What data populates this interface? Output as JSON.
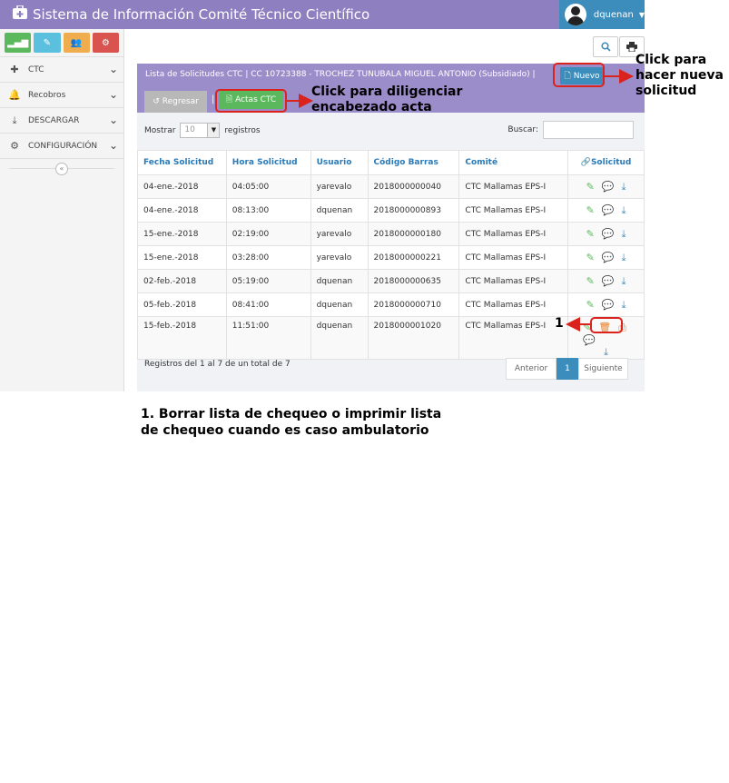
{
  "header": {
    "app_title": "Sistema de Información Comité Técnico Científico",
    "username": "dquenan"
  },
  "sidebar": {
    "items": [
      {
        "label": "CTC",
        "icon": "medkit-icon"
      },
      {
        "label": "Recobros",
        "icon": "bell-icon"
      },
      {
        "label": "DESCARGAR",
        "icon": "download-icon"
      },
      {
        "label": "CONFIGURACIÓN",
        "icon": "cogs-icon"
      }
    ]
  },
  "panel": {
    "title": "Lista de Solicitudes CTC | CC 10723388 - TROCHEZ TUNUBALA MIGUEL ANTONIO (Subsidiado) |",
    "nuevo_label": "Nuevo",
    "regresar_label": "Regresar",
    "actas_label": "Actas CTC"
  },
  "table_controls": {
    "show_label": "Mostrar",
    "page_length": "10",
    "records_label": "registros",
    "search_label": "Buscar:"
  },
  "table": {
    "headers": [
      "Fecha Solicitud",
      "Hora Solicitud",
      "Usuario",
      "Código Barras",
      "Comité",
      "Solicitud"
    ],
    "rows": [
      [
        "04-ene.-2018",
        "04:05:00",
        "yarevalo",
        "2018000000040",
        "CTC Mallamas EPS-I"
      ],
      [
        "04-ene.-2018",
        "08:13:00",
        "dquenan",
        "2018000000893",
        "CTC Mallamas EPS-I"
      ],
      [
        "15-ene.-2018",
        "02:19:00",
        "yarevalo",
        "2018000000180",
        "CTC Mallamas EPS-I"
      ],
      [
        "15-ene.-2018",
        "03:28:00",
        "yarevalo",
        "2018000000221",
        "CTC Mallamas EPS-I"
      ],
      [
        "02-feb.-2018",
        "05:19:00",
        "dquenan",
        "2018000000635",
        "CTC Mallamas EPS-I"
      ],
      [
        "05-feb.-2018",
        "08:41:00",
        "dquenan",
        "2018000000710",
        "CTC Mallamas EPS-I"
      ],
      [
        "15-feb.-2018",
        "11:51:00",
        "dquenan",
        "2018000001020",
        "CTC Mallamas EPS-I"
      ]
    ]
  },
  "footer": {
    "info": "Registros del 1 al 7 de un total de 7",
    "prev_label": "Anterior",
    "current_page": "1",
    "next_label": "Siguiente"
  },
  "annotations": {
    "nuevo_note": "Click para\nhacer nueva\nsolicitud",
    "actas_note": "Click para diligenciar\nencabezado acta",
    "row_marker": "1",
    "footnote": "1. Borrar lista de chequeo o imprimir lista\nde chequeo cuando es caso ambulatorio"
  },
  "colors": {
    "header_bg": "#8d7fc0",
    "user_bg": "#3c8dbc",
    "panel_head_bg": "#9b8cca",
    "annotation_red": "#d9231c"
  }
}
